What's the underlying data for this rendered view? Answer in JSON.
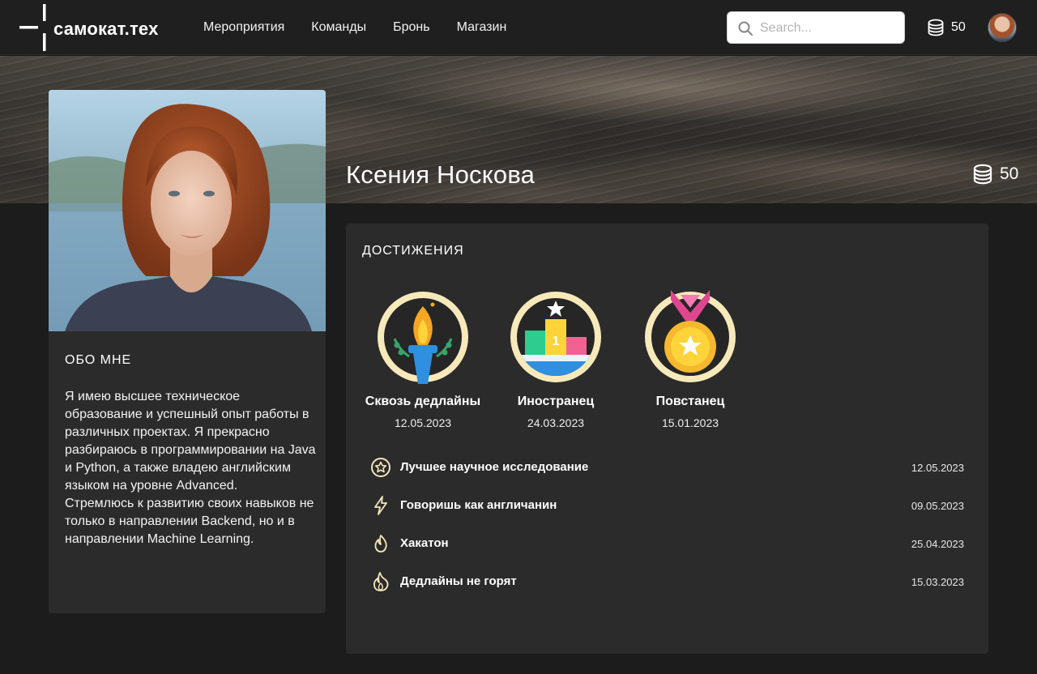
{
  "header": {
    "logo_text": "самокат.тех",
    "nav": [
      "Мероприятия",
      "Команды",
      "Бронь",
      "Магазин"
    ],
    "search_placeholder": "Search...",
    "coins": "50"
  },
  "profile": {
    "name": "Ксения Носкова",
    "coins": "50"
  },
  "about": {
    "title": "ОБО МНЕ",
    "text": "Я имею высшее техническое образование и успешный опыт работы в различных проектах. Я прекрасно разбираюсь в программировании на Java и Python, а также владею английским языком на уровне Advanced.\nСтремлюсь к развитию своих навыков не только в направлении Backend, но и в направлении Machine Learning."
  },
  "achievements": {
    "title": "ДОСТИЖЕНИЯ",
    "badges": [
      {
        "name": "Сквозь дедлайны",
        "date": "12.05.2023",
        "icon": "torch-medal-icon"
      },
      {
        "name": "Иностранец",
        "date": "24.03.2023",
        "icon": "podium-medal-icon"
      },
      {
        "name": "Повстанец",
        "date": "15.01.2023",
        "icon": "gold-medal-icon"
      }
    ],
    "list": [
      {
        "name": "Лучшее научное исследование",
        "date": "12.05.2023",
        "icon": "star-circle-icon"
      },
      {
        "name": "Говоришь как англичанин",
        "date": "09.05.2023",
        "icon": "lightning-icon"
      },
      {
        "name": "Хакатон",
        "date": "25.04.2023",
        "icon": "flame-icon"
      },
      {
        "name": "Дедлайны не горят",
        "date": "15.03.2023",
        "icon": "fire-icon"
      }
    ]
  },
  "colors": {
    "background": "#1c1c1c",
    "card": "#2b2b2b",
    "accent": "#f5e6b8",
    "header": "#1f1f1f"
  }
}
